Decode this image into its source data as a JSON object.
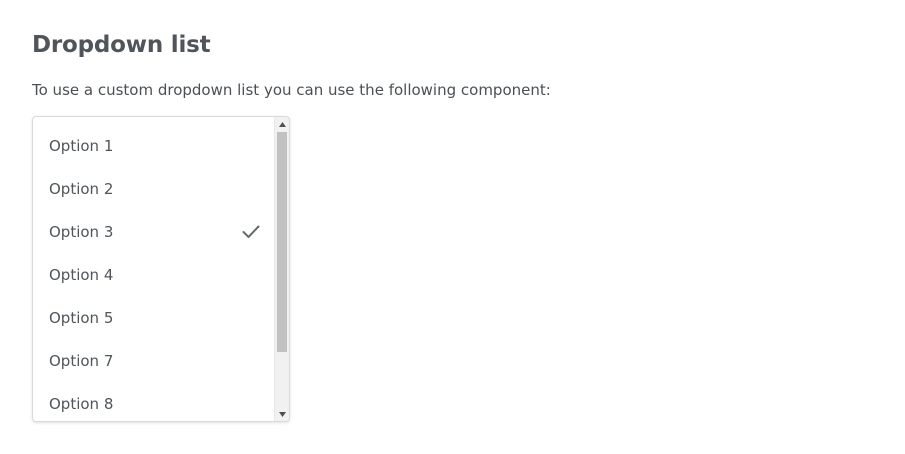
{
  "page": {
    "title": "Dropdown list",
    "intro": "To use a custom dropdown list you can use the following component:"
  },
  "dropdown": {
    "selected_value": "Option 3",
    "options": [
      {
        "label": "Option 1",
        "selected": false
      },
      {
        "label": "Option 2",
        "selected": false
      },
      {
        "label": "Option 3",
        "selected": true
      },
      {
        "label": "Option 4",
        "selected": false
      },
      {
        "label": "Option 5",
        "selected": false
      },
      {
        "label": "Option 7",
        "selected": false
      },
      {
        "label": "Option 8",
        "selected": false
      }
    ],
    "check_icon": "checkmark-icon",
    "check_color": "#666a70"
  }
}
